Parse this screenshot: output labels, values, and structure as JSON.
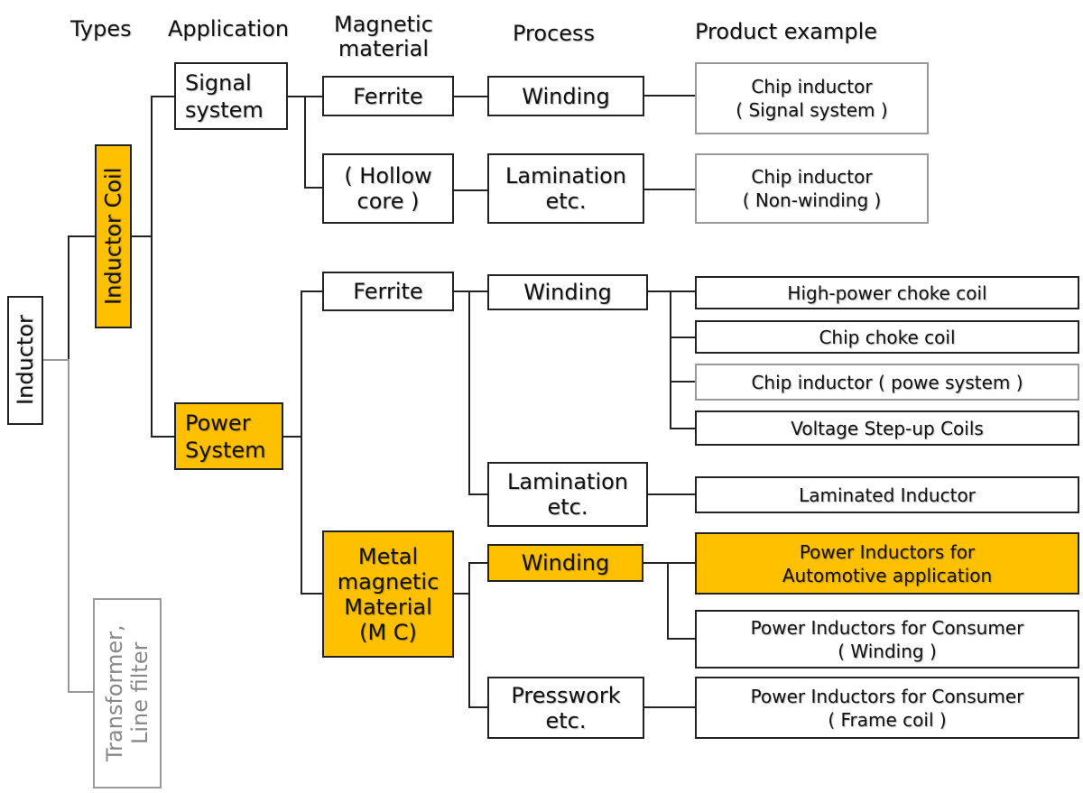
{
  "colors": {
    "highlight": "#FFC000",
    "line": "#222222",
    "muted": "#999999"
  },
  "headers": {
    "types": "Types",
    "application": "Application",
    "magnetic_material": "Magnetic\nmaterial",
    "process": "Process",
    "product_example": "Product example"
  },
  "nodes": {
    "inductor": "Inductor",
    "inductor_coil": "Inductor Coil",
    "transformer": "Transformer,\nLine filter",
    "signal_system": "Signal\nsystem",
    "power_system": "Power\nSystem",
    "ferrite_signal": "Ferrite",
    "hollow_core": "( Hollow\n  core  )",
    "winding_signal": "Winding",
    "lamination_signal": "Lamination\netc.",
    "chip_inductor_signal": "Chip inductor\n( Signal system )",
    "chip_inductor_nonwinding": "Chip inductor\n( Non-winding )",
    "ferrite_power": "Ferrite",
    "winding_power": "Winding",
    "lamination_power": "Lamination\netc.",
    "high_power_choke": "High-power choke coil",
    "chip_choke": "Chip choke coil",
    "chip_inductor_power": "Chip inductor  ( powe system )",
    "voltage_stepup": "Voltage Step-up Coils",
    "laminated_inductor": "Laminated Inductor",
    "metal_mc": "Metal\nmagnetic\nMaterial\n(M C)",
    "winding_mc": "Winding",
    "presswork": "Presswork\netc.",
    "power_automotive": "Power Inductors for\nAutomotive application",
    "power_consumer_winding": "Power Inductors for Consumer\n( Winding )",
    "power_consumer_frame": "Power Inductors for Consumer\n( Frame coil )"
  }
}
